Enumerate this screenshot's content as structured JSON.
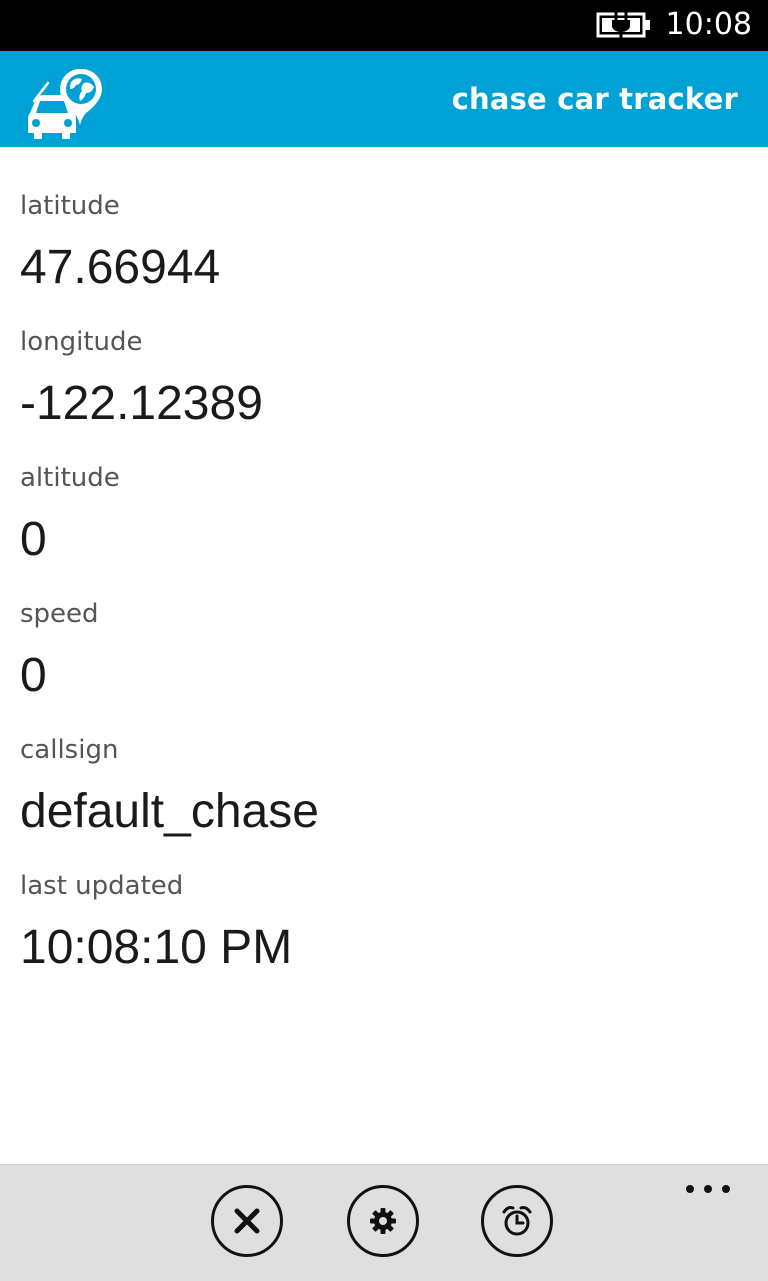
{
  "status_bar": {
    "time": "10:08",
    "battery_icon": "battery-charging-icon"
  },
  "header": {
    "logo_icon": "car-globe-pin-logo-icon",
    "title": "chase car tracker",
    "background_color": "#00a2d6"
  },
  "fields": [
    {
      "label": "latitude",
      "value": "47.66944"
    },
    {
      "label": "longitude",
      "value": "-122.12389"
    },
    {
      "label": "altitude",
      "value": "0"
    },
    {
      "label": "speed",
      "value": "0"
    },
    {
      "label": "callsign",
      "value": "default_chase"
    },
    {
      "label": "last updated",
      "value": "10:08:10 PM"
    }
  ],
  "app_bar": {
    "buttons": [
      {
        "icon": "close-icon"
      },
      {
        "icon": "gear-icon"
      },
      {
        "icon": "alarm-clock-icon"
      }
    ],
    "more_icon": "ellipsis-icon",
    "background_color": "#dfdfdf"
  }
}
